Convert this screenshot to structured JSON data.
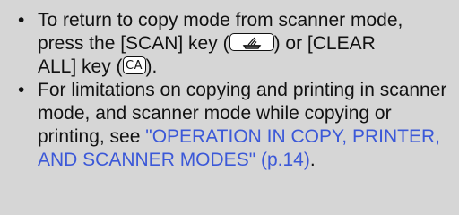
{
  "notes": {
    "item1": {
      "line1": "To return to copy mode from scanner mode,",
      "line2a": "press the [SCAN] key (",
      "scan_key_icon": "scanner-key-icon",
      "line2b": ") or [CLEAR",
      "line3a": "ALL] key (",
      "clear_key_label": "CA",
      "line3b": ")."
    },
    "item2": {
      "text_before": "For limitations on copying and printing in scanner mode, and scanner mode while copying or printing, see ",
      "link_text": "\"OPERATION IN COPY, PRINTER, AND SCANNER MODES\" (p.14)",
      "text_after": "."
    }
  },
  "colors": {
    "background": "#d6d6d6",
    "text": "#111111",
    "link": "#3b58d8"
  }
}
